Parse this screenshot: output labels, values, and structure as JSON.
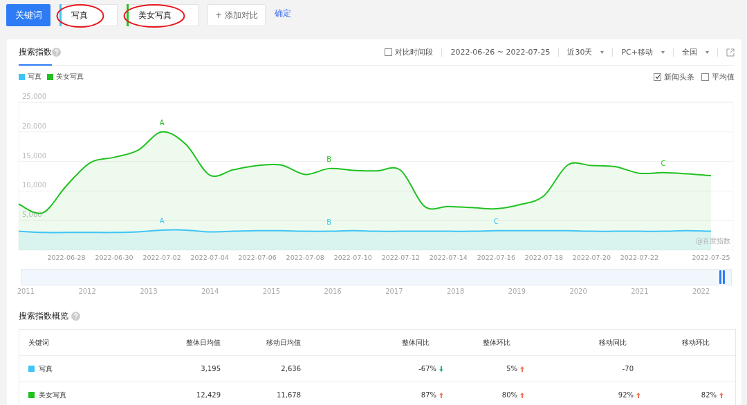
{
  "search_bar": {
    "label": "关键词",
    "keywords": [
      {
        "text": "写真",
        "color": "#3ec5f5",
        "circled": true
      },
      {
        "text": "美女写真",
        "color": "#21c121",
        "circled": true
      }
    ],
    "add_button": "+ 添加对比",
    "confirm": "确定"
  },
  "trend": {
    "tab": {
      "label": "搜索指数",
      "selected": true
    },
    "compare": {
      "label": "对比时间段",
      "checked": false
    },
    "date_range": "2022-06-26 ~ 2022-07-25",
    "dropdowns": [
      "近30天",
      "PC+移动",
      "全国"
    ],
    "options": [
      {
        "label": "新闻头条",
        "checked": true
      },
      {
        "label": "平均值",
        "checked": false
      }
    ],
    "chart_watermark": "@百度指数",
    "chart_data": {
      "type": "area",
      "grid": true,
      "categories": [
        null,
        null,
        "2022-06-28",
        null,
        "2022-06-30",
        null,
        "2022-07-02",
        null,
        "2022-07-04",
        null,
        "2022-07-06",
        null,
        "2022-07-08",
        null,
        "2022-07-10",
        null,
        "2022-07-12",
        null,
        "2022-07-14",
        null,
        "2022-07-16",
        null,
        "2022-07-18",
        null,
        "2022-07-20",
        null,
        "2022-07-22",
        null,
        null,
        "2022-07-25"
      ],
      "series": [
        {
          "name": "写真",
          "color": "#3ec5f5",
          "values": [
            3200,
            3000,
            3000,
            3000,
            3000,
            3100,
            3400,
            3400,
            3100,
            3200,
            3300,
            3300,
            3200,
            3200,
            3300,
            3200,
            3200,
            3200,
            3200,
            3200,
            3300,
            3300,
            3300,
            3300,
            3200,
            3200,
            3200,
            3200,
            3300,
            3200
          ]
        },
        {
          "name": "美女写真",
          "color": "#21c121",
          "values": [
            7800,
            6300,
            10900,
            14800,
            15700,
            16900,
            20000,
            17900,
            12700,
            13600,
            14300,
            14400,
            12800,
            13800,
            13500,
            13400,
            13500,
            7400,
            7400,
            7200,
            7000,
            7700,
            9200,
            14400,
            14300,
            14100,
            13000,
            13100,
            12900,
            12600
          ]
        }
      ],
      "ylim": [
        0,
        25000
      ],
      "yticks": [
        {
          "value": 5000,
          "label": "5,000"
        },
        {
          "value": 10000,
          "label": "10,000"
        },
        {
          "value": 15000,
          "label": "15,000"
        },
        {
          "value": 20000,
          "label": "20,000"
        },
        {
          "value": 25000,
          "label": "25,000"
        }
      ]
    },
    "event_marks": [
      [
        "A",
        "B",
        "C"
      ],
      [
        "A",
        "B",
        "C"
      ]
    ],
    "range_slider": {
      "level": 0.99,
      "years": [
        "2011",
        "2012",
        "2013",
        "2014",
        "2015",
        "2016",
        "2017",
        "2018",
        "2019",
        "2020",
        "2021",
        "2022"
      ]
    }
  },
  "overview": {
    "title": "搜索指数概览",
    "columns": [
      "关键词",
      "整体日均值",
      "移动日均值",
      "整体同比",
      "整体环比",
      "移动同比",
      "移动环比"
    ],
    "rows": [
      {
        "color": "#3ec5f5",
        "cells": [
          {
            "text": "写真"
          },
          {
            "text": "3,195"
          },
          {
            "text": "2,636"
          },
          {
            "text": "-67%",
            "rising": false
          },
          {
            "text": "5%",
            "rising": true
          },
          {
            "text": "-70"
          }
        ]
      },
      {
        "color": "#21c121",
        "cells": [
          {
            "text": "美女写真"
          },
          {
            "text": "12,429"
          },
          {
            "text": "11,678"
          },
          {
            "text": "87%",
            "rising": true
          },
          {
            "text": "80%",
            "rising": true
          },
          {
            "text": "92%",
            "rising": true
          },
          {
            "text": "82%",
            "rising": true
          }
        ]
      }
    ]
  }
}
